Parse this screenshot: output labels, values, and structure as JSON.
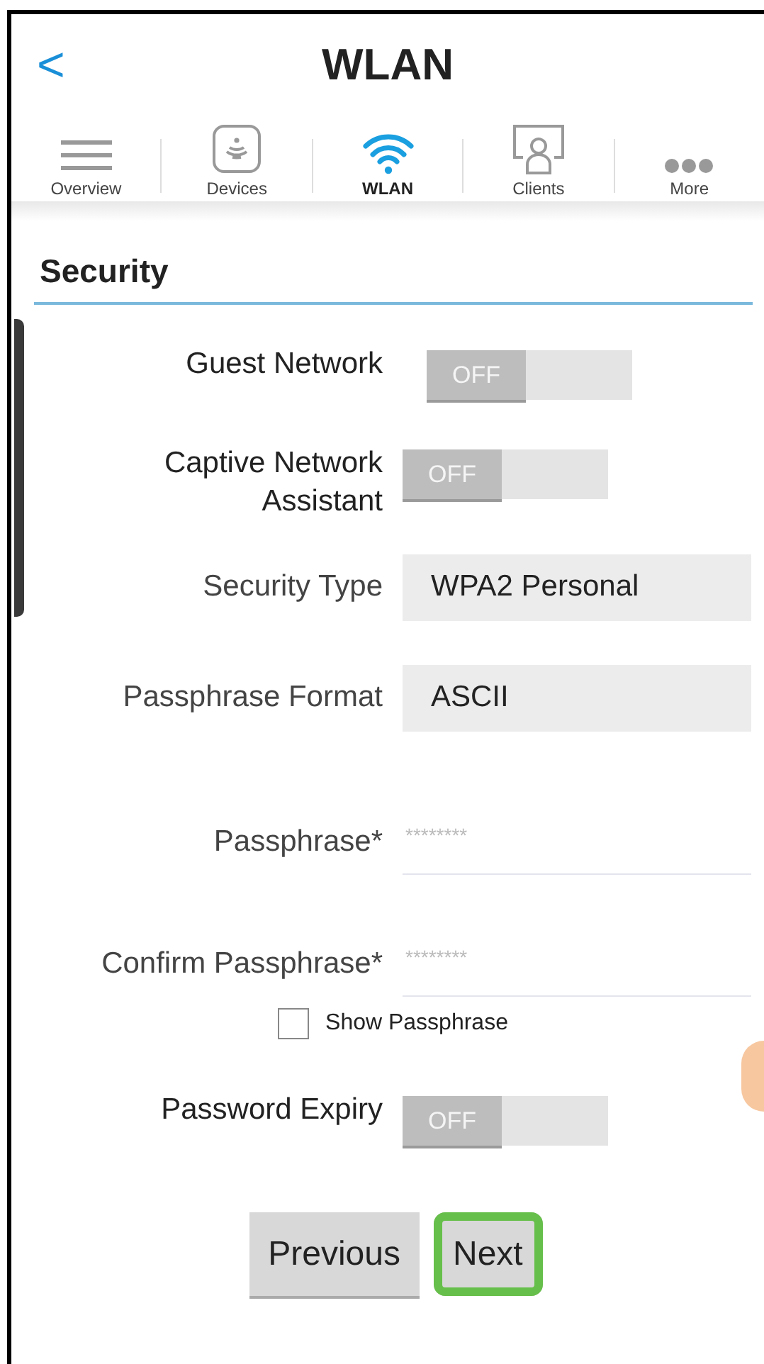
{
  "header": {
    "back": "<",
    "title": "WLAN"
  },
  "tabs": [
    {
      "label": "Overview",
      "kind": "menu",
      "selected": false
    },
    {
      "label": "Devices",
      "kind": "device",
      "selected": false
    },
    {
      "label": "WLAN",
      "kind": "wifi",
      "selected": true
    },
    {
      "label": "Clients",
      "kind": "clients",
      "selected": false
    },
    {
      "label": "More",
      "kind": "more",
      "selected": false
    }
  ],
  "section": {
    "title": "Security"
  },
  "fields": [
    {
      "kind": "toggle",
      "label": "Guest Network",
      "on": false,
      "state_text": "OFF"
    },
    {
      "kind": "toggle",
      "label": "Captive Network Assistant",
      "on": false,
      "state_text": "OFF"
    },
    {
      "kind": "select",
      "label": "Security Type",
      "value": "WPA2 Personal"
    },
    {
      "kind": "select",
      "label": "Passphrase Format",
      "value": "ASCII"
    },
    {
      "kind": "password",
      "label": "Passphrase*",
      "placeholder": "********"
    },
    {
      "kind": "password",
      "label": "Confirm Passphrase*",
      "placeholder": "********"
    },
    {
      "kind": "checkbox",
      "label": "Show Passphrase",
      "checked": false
    },
    {
      "kind": "toggle",
      "label": "Password Expiry",
      "on": false,
      "state_text": "OFF"
    }
  ],
  "buttons": [
    {
      "label": "Previous",
      "highlighted": false
    },
    {
      "label": "Next",
      "highlighted": true
    }
  ]
}
